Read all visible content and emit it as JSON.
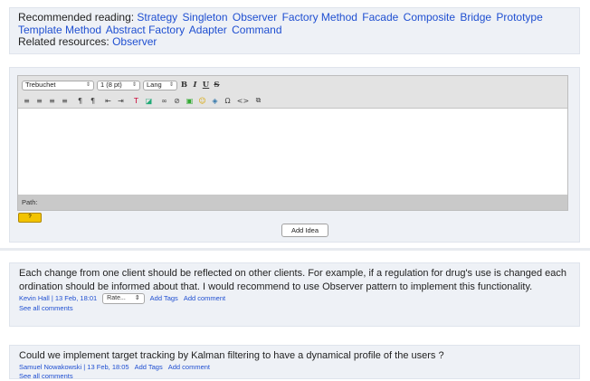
{
  "reading": {
    "label": "Recommended reading:",
    "links": [
      "Strategy",
      "Singleton",
      "Observer",
      "Factory Method",
      "Facade",
      "Composite",
      "Bridge",
      "Prototype",
      "Template Method",
      "Abstract Factory",
      "Adapter",
      "Command"
    ],
    "related_label": "Related resources:",
    "related_link": "Observer"
  },
  "editor": {
    "font_select": "Trebuchet",
    "size_select": "1 (8 pt)",
    "lang_select": "Lang",
    "bold": "B",
    "italic": "I",
    "underline": "U",
    "strike": "S",
    "path_label": "Path:",
    "help_badge": "?",
    "add_button": "Add Idea"
  },
  "comments": [
    {
      "text": "Each change from one client should be reflected on other clients. For example, if a regulation for drug's use is changed each ordination should be informed about that. I would recommend to use Observer pattern to implement this functionality.",
      "author_line": "Kevin Hall | 13 Feb, 18:01",
      "rate_label": "Rate...",
      "add_tags": "Add Tags",
      "add_comment": "Add comment",
      "see_all": "See all comments"
    },
    {
      "text": "Could we implement target tracking by Kalman filtering to have a dynamical profile of the users ?",
      "author_line": "Samuel Nowakowski | 13 Feb, 18:05",
      "add_tags": "Add Tags",
      "add_comment": "Add comment",
      "see_all": "See all comments"
    }
  ]
}
